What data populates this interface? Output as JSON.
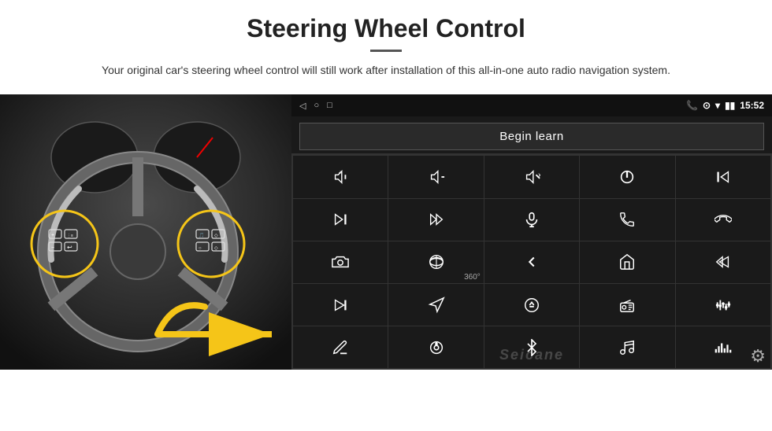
{
  "header": {
    "title": "Steering Wheel Control",
    "divider": true,
    "description": "Your original car's steering wheel control will still work after installation of this all-in-one auto radio navigation system."
  },
  "android_screen": {
    "status_bar": {
      "time": "15:52",
      "nav_icons": [
        "◁",
        "○",
        "□"
      ],
      "right_icons": [
        "📞",
        "⊙",
        "▾"
      ]
    },
    "begin_learn_label": "Begin learn",
    "watermark": "Seicane",
    "icons": [
      {
        "id": "vol-up",
        "symbol": "vol+"
      },
      {
        "id": "vol-down",
        "symbol": "vol-"
      },
      {
        "id": "mute",
        "symbol": "mute"
      },
      {
        "id": "power",
        "symbol": "pwr"
      },
      {
        "id": "track-prev",
        "symbol": "prev"
      },
      {
        "id": "next-track",
        "symbol": "next"
      },
      {
        "id": "ff",
        "symbol": "ff"
      },
      {
        "id": "mic",
        "symbol": "mic"
      },
      {
        "id": "call",
        "symbol": "call"
      },
      {
        "id": "end-call",
        "symbol": "end"
      },
      {
        "id": "camera",
        "symbol": "cam"
      },
      {
        "id": "360-view",
        "symbol": "360"
      },
      {
        "id": "back",
        "symbol": "back"
      },
      {
        "id": "home",
        "symbol": "home"
      },
      {
        "id": "skip-prev",
        "symbol": "skp"
      },
      {
        "id": "fast-forward",
        "symbol": "fwd"
      },
      {
        "id": "nav",
        "symbol": "nav"
      },
      {
        "id": "eject",
        "symbol": "eje"
      },
      {
        "id": "radio",
        "symbol": "rad"
      },
      {
        "id": "eq",
        "symbol": "eq"
      },
      {
        "id": "pen",
        "symbol": "pen"
      },
      {
        "id": "settings2",
        "symbol": "set"
      },
      {
        "id": "bluetooth",
        "symbol": "bt"
      },
      {
        "id": "music",
        "symbol": "mus"
      },
      {
        "id": "volume-bars",
        "symbol": "vol"
      }
    ]
  },
  "gear_icon_label": "⚙"
}
